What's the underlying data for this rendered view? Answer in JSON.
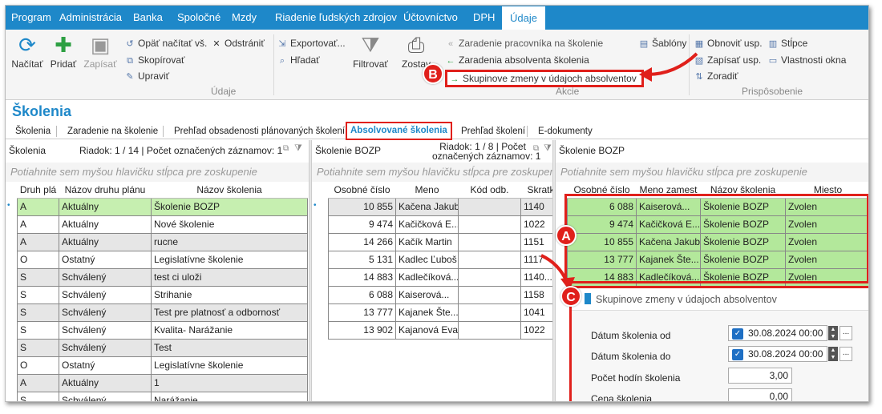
{
  "menu": [
    "Program",
    "Administrácia",
    "Banka",
    "Spoločné",
    "Mzdy",
    "Riadenie ľudských zdrojov",
    "Účtovníctvo",
    "DPH",
    "Údaje"
  ],
  "ribbon": {
    "load": "Načítať",
    "add": "Pridať",
    "save": "Zapísať",
    "reload": "Opäť načítať vš.",
    "remove": "Odstrániť",
    "copy": "Skopírovať",
    "edit": "Upraviť",
    "export": "Exportovať...",
    "find": "Hľadať",
    "filter": "Filtrovať",
    "reports": "Zostav",
    "group_data": "Údaje",
    "action1": "Zaradenie pracovníka na školenie",
    "action2": "Zaradenia absolventa školenia",
    "action3": "Skupinove zmeny v údajoch absolventov",
    "templates": "Šablóny",
    "group_actions": "Akcie",
    "restore": "Obnoviť usp.",
    "columns": "Stĺpce",
    "write": "Zapísať usp.",
    "props": "Vlastnosti okna",
    "sort": "Zoradiť",
    "group_custom": "Prispôsobenie"
  },
  "page_title": "Školenia",
  "tabs": [
    "Školenia",
    "Zaradenie na školenie",
    "Prehľad obsadenosti plánovaných školení",
    "Absolvované školenia",
    "Prehľad školení",
    "E-dokumenty"
  ],
  "group_hint": "Potiahnite sem myšou hlavičku stĺpca pre zoskupenie",
  "left": {
    "title": "Školenia",
    "info": "Riadok: 1 / 14 | Počet označených záznamov: 1",
    "cols": [
      "Druh plá",
      "Názov druhu plánu",
      "Názov školenia"
    ],
    "rows": [
      [
        "A",
        "Aktuálny",
        "Školenie BOZP"
      ],
      [
        "A",
        "Aktuálny",
        "Nové školenie"
      ],
      [
        "A",
        "Aktuálny",
        "rucne"
      ],
      [
        "O",
        "Ostatný",
        "Legislatívne školenie"
      ],
      [
        "S",
        "Schválený",
        "test ci uloži"
      ],
      [
        "S",
        "Schválený",
        "Strihanie"
      ],
      [
        "S",
        "Schválený",
        "Test pre platnosť a odbornosť"
      ],
      [
        "S",
        "Schválený",
        "Kvalita- Narážanie"
      ],
      [
        "S",
        "Schválený",
        "Test"
      ],
      [
        "O",
        "Ostatný",
        "Legislatívne školenie"
      ],
      [
        "A",
        "Aktuálny",
        "1"
      ],
      [
        "S",
        "Schválený",
        "Narážanie"
      ]
    ]
  },
  "middle": {
    "title": "Školenie BOZP",
    "info1": "Riadok: 1 / 8 | Počet",
    "info2": "označených záznamov: 1",
    "cols": [
      "Osobné číslo",
      "Meno",
      "Kód odb.",
      "Skratk"
    ],
    "rows": [
      [
        "10 855",
        "Kačena Jakub",
        "",
        "1140"
      ],
      [
        "9 474",
        "Kačičková E...",
        "",
        "1022"
      ],
      [
        "14 266",
        "Kačík Martin",
        "",
        "1151"
      ],
      [
        "5 131",
        "Kadlec Ľuboš",
        "",
        "1117"
      ],
      [
        "14 883",
        "Kadlečíková...",
        "",
        "1140..."
      ],
      [
        "6 088",
        "Kaiserová...",
        "",
        "1158"
      ],
      [
        "13 777",
        "Kajanek Šte...",
        "",
        "1041"
      ],
      [
        "13 902",
        "Kajanová Eva",
        "",
        "1022"
      ]
    ]
  },
  "right": {
    "title": "Školenie BOZP",
    "cols": [
      "Osobné číslo",
      "Meno zamest",
      "Názov školenia",
      "Miesto"
    ],
    "rows": [
      [
        "6 088",
        "Kaiserová...",
        "Školenie BOZP",
        "Zvolen"
      ],
      [
        "9 474",
        "Kačičková E...",
        "Školenie BOZP",
        "Zvolen"
      ],
      [
        "10 855",
        "Kačena Jakub",
        "Školenie BOZP",
        "Zvolen"
      ],
      [
        "13 777",
        "Kajanek Šte...",
        "Školenie BOZP",
        "Zvolen"
      ],
      [
        "14 883",
        "Kadlečíková...",
        "Školenie BOZP",
        "Zvolen"
      ]
    ]
  },
  "dialog": {
    "title": "Skupinove zmeny v údajoch absolventov",
    "date_from_label": "Dátum školenia od",
    "date_from": "30.08.2024 00:00",
    "date_to_label": "Dátum školenia do",
    "date_to": "30.08.2024 00:00",
    "hours_label": "Počet hodín školenia",
    "hours": "3,00",
    "price_label": "Cena školenia",
    "price": "0,00"
  },
  "badges": {
    "a": "A",
    "b": "B",
    "c": "C"
  },
  "colors": {
    "accent": "#1e88c9",
    "highlight": "#e0201b",
    "selected_row": "#b3e89b"
  }
}
